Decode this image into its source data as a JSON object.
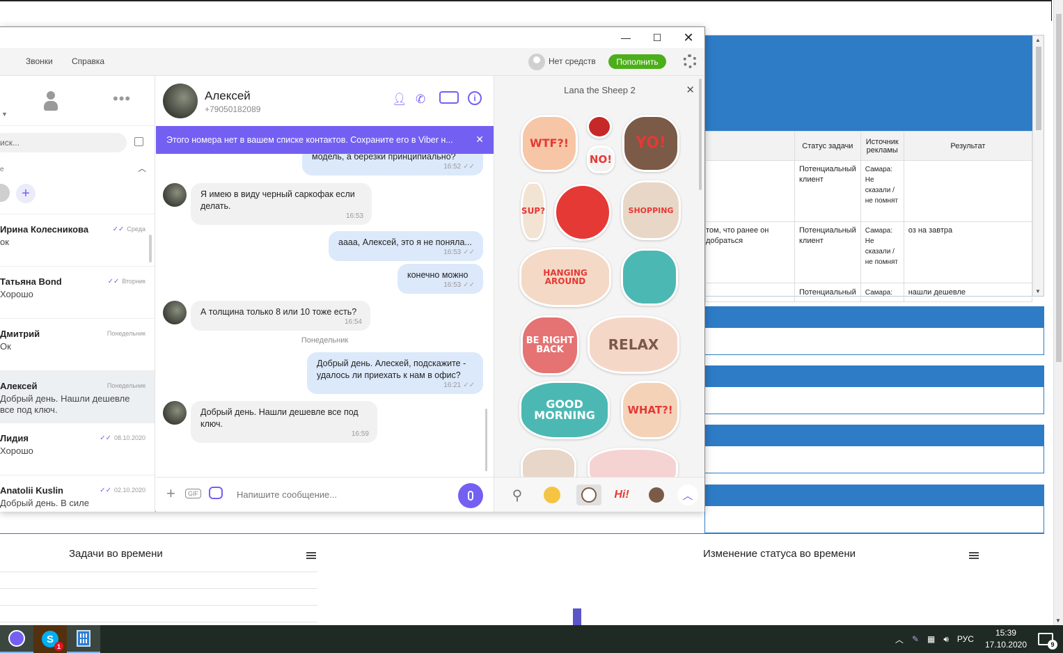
{
  "viber": {
    "menu": {
      "calls": "Звонки",
      "help": "Справка"
    },
    "account": {
      "balance": "Нет средств",
      "topup": "Пополнить"
    },
    "left": {
      "search_placeholder": "иск...",
      "favorites_label": "е",
      "chats": [
        {
          "name": "Ирина Колесникова",
          "message": "ок",
          "date": "Среда",
          "read": true
        },
        {
          "name": "Татьяна Bond",
          "message": "Хорошо",
          "date": "Вторник",
          "read": true
        },
        {
          "name": "Дмитрий",
          "message": "Ок",
          "date": "Понедельник",
          "read": false
        },
        {
          "name": "Алексей",
          "message": "Добрый день. Нашли дешевле все под ключ.",
          "date": "Понедельник",
          "read": false,
          "selected": true
        },
        {
          "name": "Лидия",
          "message": "Хорошо",
          "date": "08.10.2020",
          "read": true
        },
        {
          "name": "Anatolii Kuslin",
          "message": "Добрый день. В силе",
          "date": "02.10.2020",
          "read": true
        }
      ]
    },
    "chat": {
      "contact_name": "Алексей",
      "contact_phone": "+79050182089",
      "banner": "Этого номера нет в вашем списке контактов. Сохраните его в Viber н...",
      "day_separator": "Понедельник",
      "messages": [
        {
          "dir": "out",
          "text": "модель, а березки принципиально?",
          "time": "16:52"
        },
        {
          "dir": "in",
          "text": "Я имею в виду черный саркофак если делать.",
          "time": "16:53"
        },
        {
          "dir": "out",
          "text": "аааа, Алексей, это я не поняла...",
          "time": "16:53"
        },
        {
          "dir": "out",
          "text": "конечно можно",
          "time": "16:53"
        },
        {
          "dir": "in",
          "text": "А толщина только 8 или 10 тоже есть?",
          "time": "16:54"
        },
        {
          "dir": "out",
          "text": "Добрый день. Алескей, подскажите - удалось ли приехать к нам в офис?",
          "time": "16:21"
        },
        {
          "dir": "in",
          "text": "Добрый день. Нашли дешевле все под ключ.",
          "time": "16:59"
        }
      ],
      "composer_placeholder": "Напишите сообщение..."
    },
    "stickers": {
      "pack_title": "Lana the Sheep 2",
      "items": [
        "WTF?!",
        "NO!",
        "YO!",
        "SUP?",
        "",
        "SHOPPING",
        "HANGING AROUND",
        "",
        "BE RIGHT BACK",
        "RELAX",
        "GOOD MORNING",
        "WHAT?!",
        "",
        ""
      ],
      "tray_icons": [
        "search-icon",
        "smiley-icon",
        "sheep-pack-icon",
        "hi-pack-icon",
        "character-pack-icon",
        "chevron-up-icon"
      ],
      "tray_hi": "Hi!"
    }
  },
  "background_page": {
    "table_headers": [
      "Статус задачи",
      "Источник рекламы",
      "Результат"
    ],
    "rows": [
      {
        "left": "",
        "status": "Потенциальный клиент",
        "source": "Самара: Не сказали / не помнят",
        "result": ""
      },
      {
        "left": "том, что ранее он добраться",
        "status": "Потенциальный клиент",
        "source": "Самара: Не сказали / не помнят",
        "result": "оз на завтра"
      },
      {
        "left": "",
        "status": "Потенциальный",
        "source": "Самара:",
        "result": "нашли дешевле"
      }
    ],
    "chart1_title": "Задачи во времени",
    "chart2_title": "Изменение статуса во времени"
  },
  "taskbar": {
    "skype_badge": "1",
    "language": "РУС",
    "time": "15:39",
    "date": "17.10.2020",
    "notifications": "9"
  }
}
